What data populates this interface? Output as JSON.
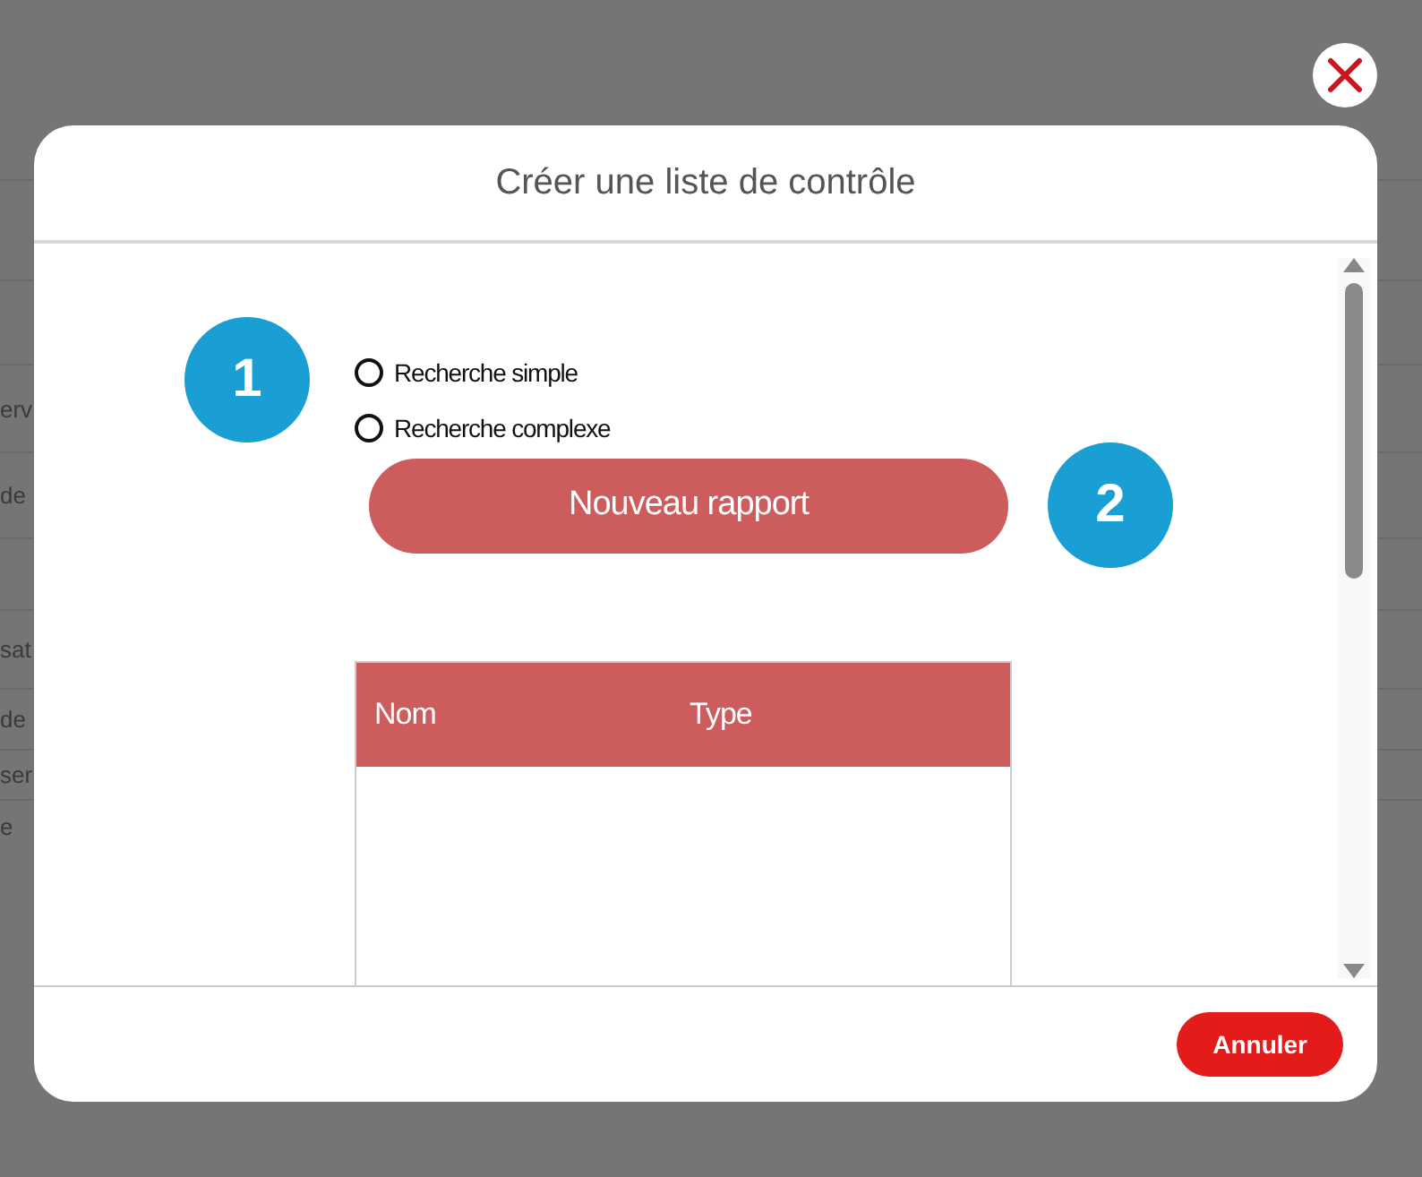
{
  "background_rows": [
    {
      "kind": "blank"
    },
    {
      "kind": "blank"
    },
    {
      "kind": "text",
      "text": "erv"
    },
    {
      "kind": "text",
      "text": "de"
    },
    {
      "kind": "blank"
    },
    {
      "kind": "text",
      "text": "sat"
    },
    {
      "kind": "text",
      "text": "de"
    },
    {
      "kind": "text",
      "text": "ser"
    },
    {
      "kind": "text",
      "text": "e"
    }
  ],
  "dialog": {
    "title": "Créer une liste de contrôle",
    "options": [
      {
        "label": "Recherche simple",
        "selected": false
      },
      {
        "label": "Recherche complexe",
        "selected": false
      }
    ],
    "new_report_button": "Nouveau rapport",
    "table": {
      "columns": [
        "Nom",
        "Type"
      ]
    },
    "cancel_button": "Annuler"
  },
  "callouts": [
    "1",
    "2"
  ]
}
